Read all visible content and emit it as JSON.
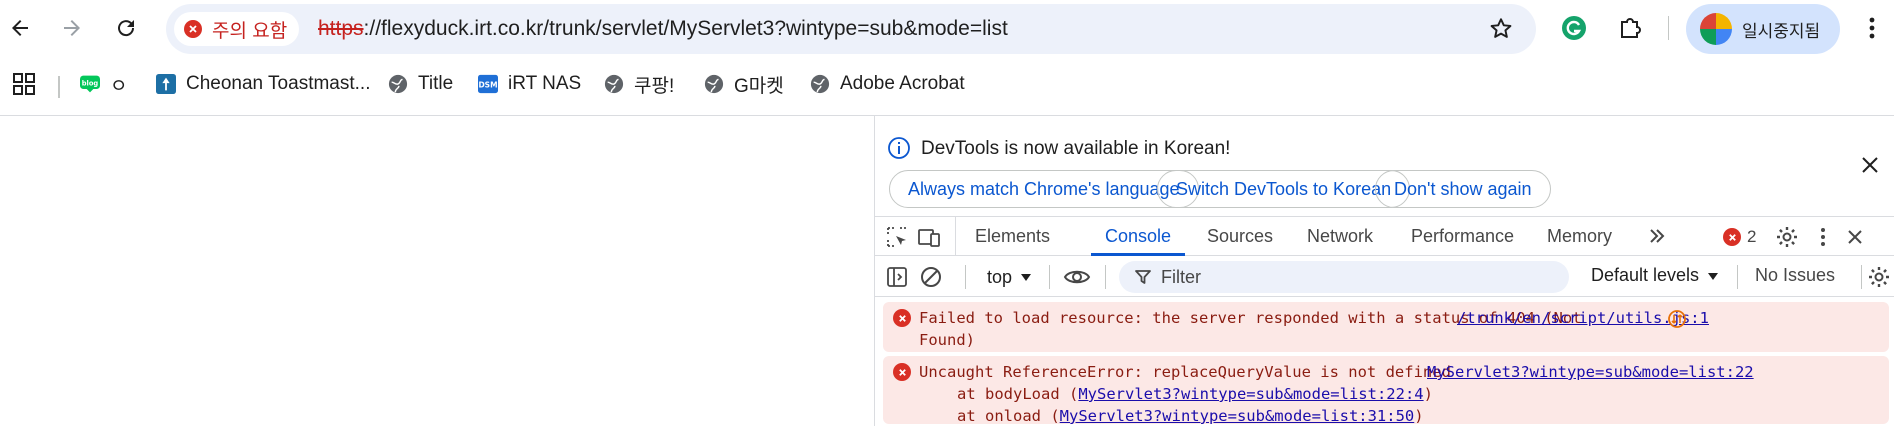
{
  "browser": {
    "security_label": "주의 요함",
    "url_scheme": "https",
    "url_rest": "://flexyduck.irt.co.kr/trunk/servlet/MyServlet3?wintype=sub&mode=list",
    "profile_name": "일시중지됨"
  },
  "bookmarks": [
    {
      "label": "ㅇ",
      "icon": "blog-icon"
    },
    {
      "label": "Cheonan Toastmast...",
      "icon": "toastmasters-icon"
    },
    {
      "label": "Title",
      "icon": "globe-icon"
    },
    {
      "label": "iRT NAS",
      "icon": "dsm-icon"
    },
    {
      "label": "쿠팡!",
      "icon": "globe-icon"
    },
    {
      "label": "G마켓",
      "icon": "globe-icon"
    },
    {
      "label": "Adobe Acrobat",
      "icon": "globe-icon"
    }
  ],
  "devtools": {
    "info_text": "DevTools is now available in Korean!",
    "info_buttons": [
      "Always match Chrome's language",
      "Switch DevTools to Korean",
      "Don't show again"
    ],
    "tabs": [
      "Elements",
      "Console",
      "Sources",
      "Network",
      "Performance",
      "Memory"
    ],
    "active_tab": "Console",
    "error_count": "2",
    "context": "top",
    "filter_placeholder": "Filter",
    "levels": "Default levels",
    "issues": "No Issues",
    "messages": [
      {
        "text": "Failed to load resource: the server responded with a status of 404 (Not\nFound)",
        "source": "/trunk/en/script/utils.js:1"
      },
      {
        "text": "Uncaught ReferenceError: replaceQueryValue is not defined",
        "source": "MyServlet3?wintype=sub&mode=list:22",
        "stack": [
          {
            "prefix": "at bodyLoad (",
            "link": "MyServlet3?wintype=sub&mode=list:22:4",
            "suffix": ")"
          },
          {
            "prefix": "at onload (",
            "link": "MyServlet3?wintype=sub&mode=list:31:50",
            "suffix": ")"
          }
        ]
      }
    ]
  },
  "colors": {
    "accent": "#0b57d0",
    "error": "#d93025",
    "error_bg": "#fce8e6"
  }
}
